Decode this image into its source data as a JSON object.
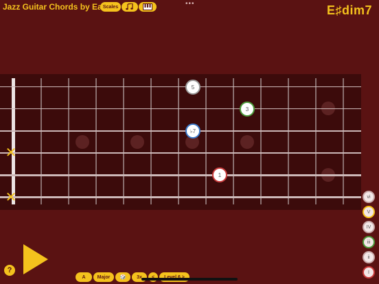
{
  "header": {
    "app_title": "Jazz Guitar Chords by Ear",
    "scales_label": "Scales",
    "music_icon": "music-notes-icon",
    "piano_icon": "piano-keys-icon",
    "more_label": "•••",
    "chord_name": "E♯dim7"
  },
  "fretboard": {
    "muted_marker": "✕",
    "notes": [
      {
        "label": "5",
        "ring_color": "#9a9a9a"
      },
      {
        "label": "3",
        "ring_color": "#4c9a3a"
      },
      {
        "label": "♭7",
        "ring_color": "#3a78c8"
      },
      {
        "label": "1",
        "ring_color": "#c83a3a"
      }
    ]
  },
  "degrees": [
    {
      "label": "vi",
      "ring_color": "#c9a9a9"
    },
    {
      "label": "V",
      "ring_color": "#f4c21d"
    },
    {
      "label": "IV",
      "ring_color": "#c9a9a9"
    },
    {
      "label": "iii",
      "ring_color": "#4c9a3a"
    },
    {
      "label": "ii",
      "ring_color": "#c9a9a9"
    },
    {
      "label": "I",
      "ring_color": "#c83a3a"
    }
  ],
  "bottom_bar": {
    "help_label": "?",
    "play_icon": "play-icon",
    "key_label": "A",
    "mode_label": "Major",
    "dice_label": "🎲",
    "speed_label": "3x",
    "prev_label": "<",
    "level_label": "Level 6  >"
  },
  "colors": {
    "background": "#5a1212",
    "fretboard": "#3c0b0b",
    "accent": "#f4c21d"
  }
}
